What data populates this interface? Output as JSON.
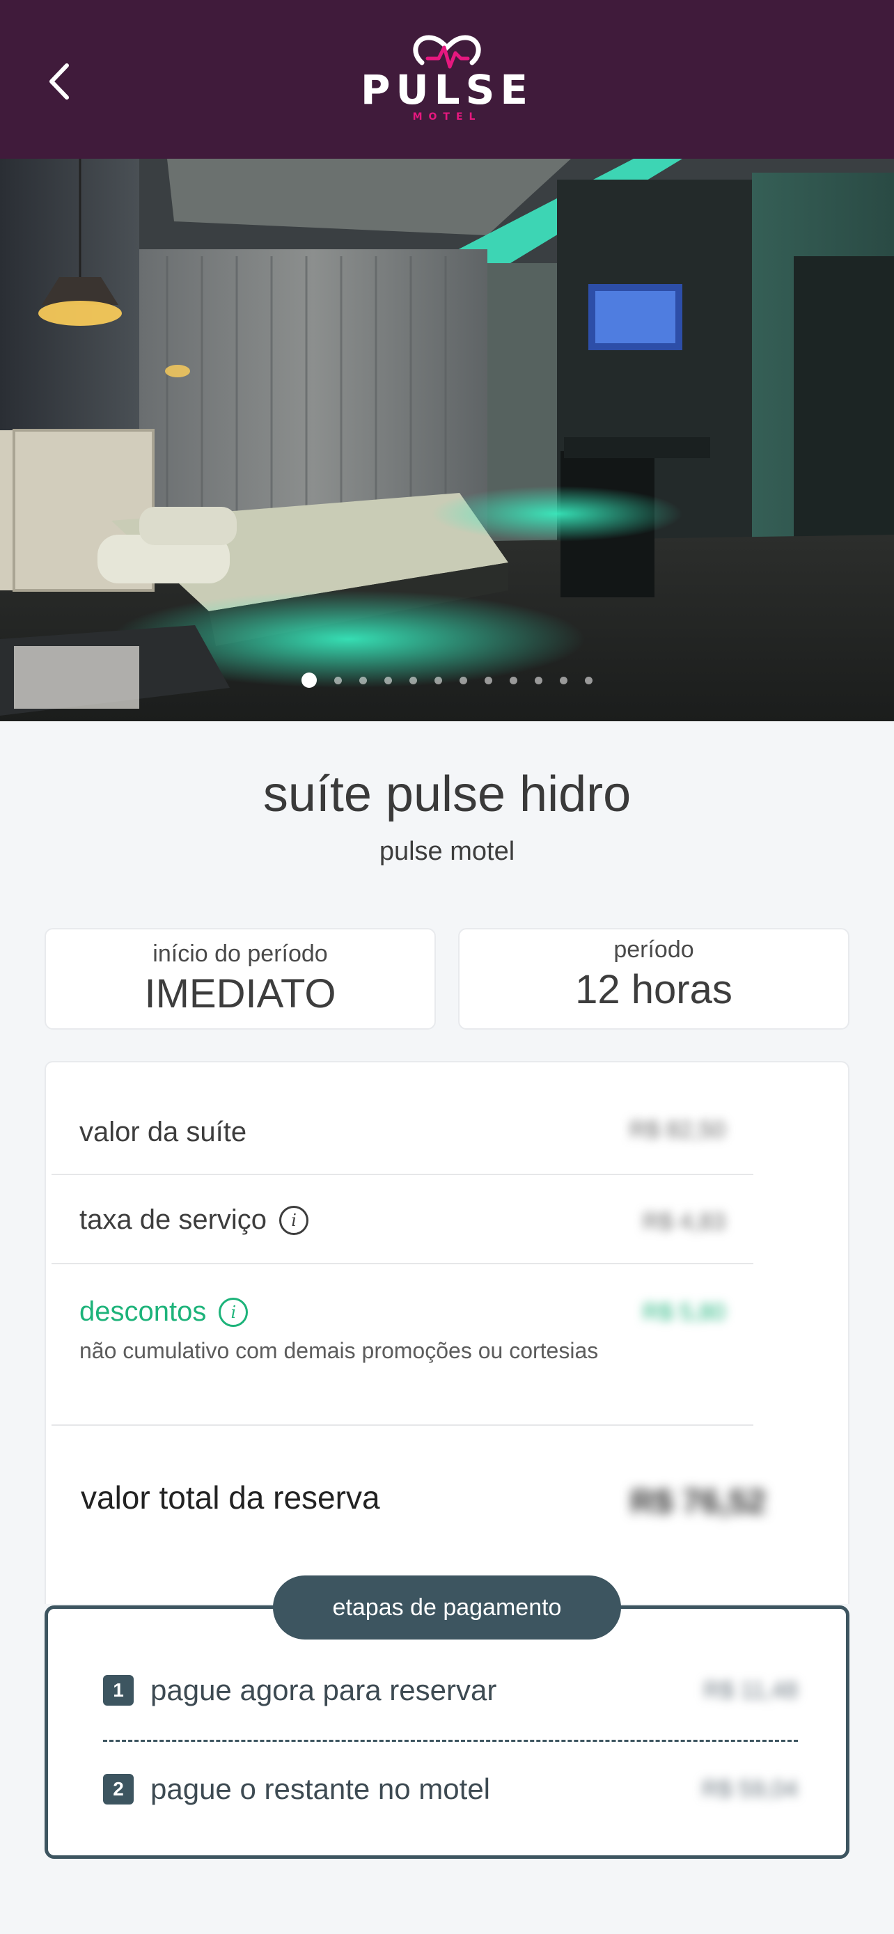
{
  "header": {
    "back_icon": "chevron-left-icon",
    "logo_text": "PULSE",
    "logo_subtext": "MOTEL",
    "colors": {
      "background": "#401b3b",
      "logo_accent": "#e6187f"
    }
  },
  "gallery": {
    "total_photos": 12,
    "active_index": 0
  },
  "suite": {
    "title": "suíte pulse hidro",
    "motel": "pulse motel"
  },
  "booking": {
    "start_label": "início do período",
    "start_value": "IMEDIATO",
    "period_label": "período",
    "period_value": "12 horas"
  },
  "pricing": {
    "suite_value_label": "valor da suíte",
    "suite_value": "R$ 82,50",
    "service_fee_label": "taxa de serviço",
    "service_fee": "R$ 4,83",
    "discounts_label": "descontos",
    "discounts_value": "R$ 5,80",
    "discounts_note": "não cumulativo com demais promoções ou cortesias",
    "total_label": "valor total da reserva",
    "total_value": "R$ 76,52",
    "colors": {
      "discount": "#1db37a"
    }
  },
  "payment_steps": {
    "title": "etapas de pagamento",
    "steps": [
      {
        "number": "1",
        "label": "pague agora para reservar",
        "value": "R$ 11,48"
      },
      {
        "number": "2",
        "label": "pague o restante no motel",
        "value": "R$ 59,04"
      }
    ],
    "colors": {
      "accent": "#3d5560"
    }
  }
}
